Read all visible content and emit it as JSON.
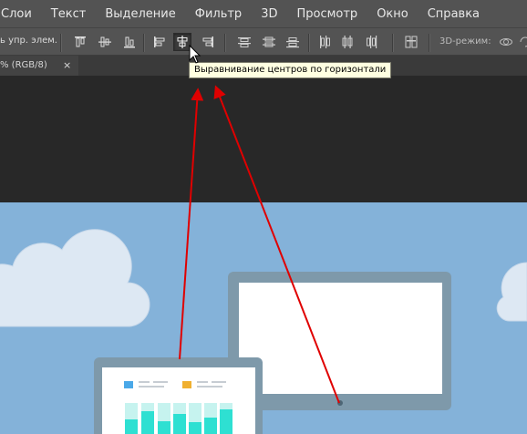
{
  "menu": {
    "items": [
      "Слои",
      "Текст",
      "Выделение",
      "Фильтр",
      "3D",
      "Просмотр",
      "Окно",
      "Справка"
    ]
  },
  "options_bar": {
    "partial_label": "ь упр. элем.",
    "mode3d_label": "3D-режим:",
    "align_buttons": [
      {
        "name": "align-top-edges-icon"
      },
      {
        "name": "align-vertical-centers-icon"
      },
      {
        "name": "align-bottom-edges-icon"
      },
      {
        "name": "align-left-edges-icon"
      },
      {
        "name": "align-horizontal-centers-icon",
        "active": true
      },
      {
        "name": "align-right-edges-icon"
      }
    ],
    "distribute_buttons": [
      {
        "name": "distribute-top-icon"
      },
      {
        "name": "distribute-vcenter-icon"
      },
      {
        "name": "distribute-bottom-icon"
      },
      {
        "name": "distribute-left-icon"
      },
      {
        "name": "distribute-hcenter-icon"
      },
      {
        "name": "distribute-right-icon"
      }
    ]
  },
  "tooltip": "Выравнивание центров по горизонтали",
  "document_tab": {
    "title": "% (RGB/8)",
    "close": "×"
  },
  "colors": {
    "ui_bg": "#535353",
    "pasteboard": "#282828",
    "artboard_sky": "#84b2d9",
    "arrow": "#e00000",
    "bar_teal": "#2ee0d2",
    "legend_blue": "#4aa8e8",
    "legend_orange": "#f0b030"
  }
}
